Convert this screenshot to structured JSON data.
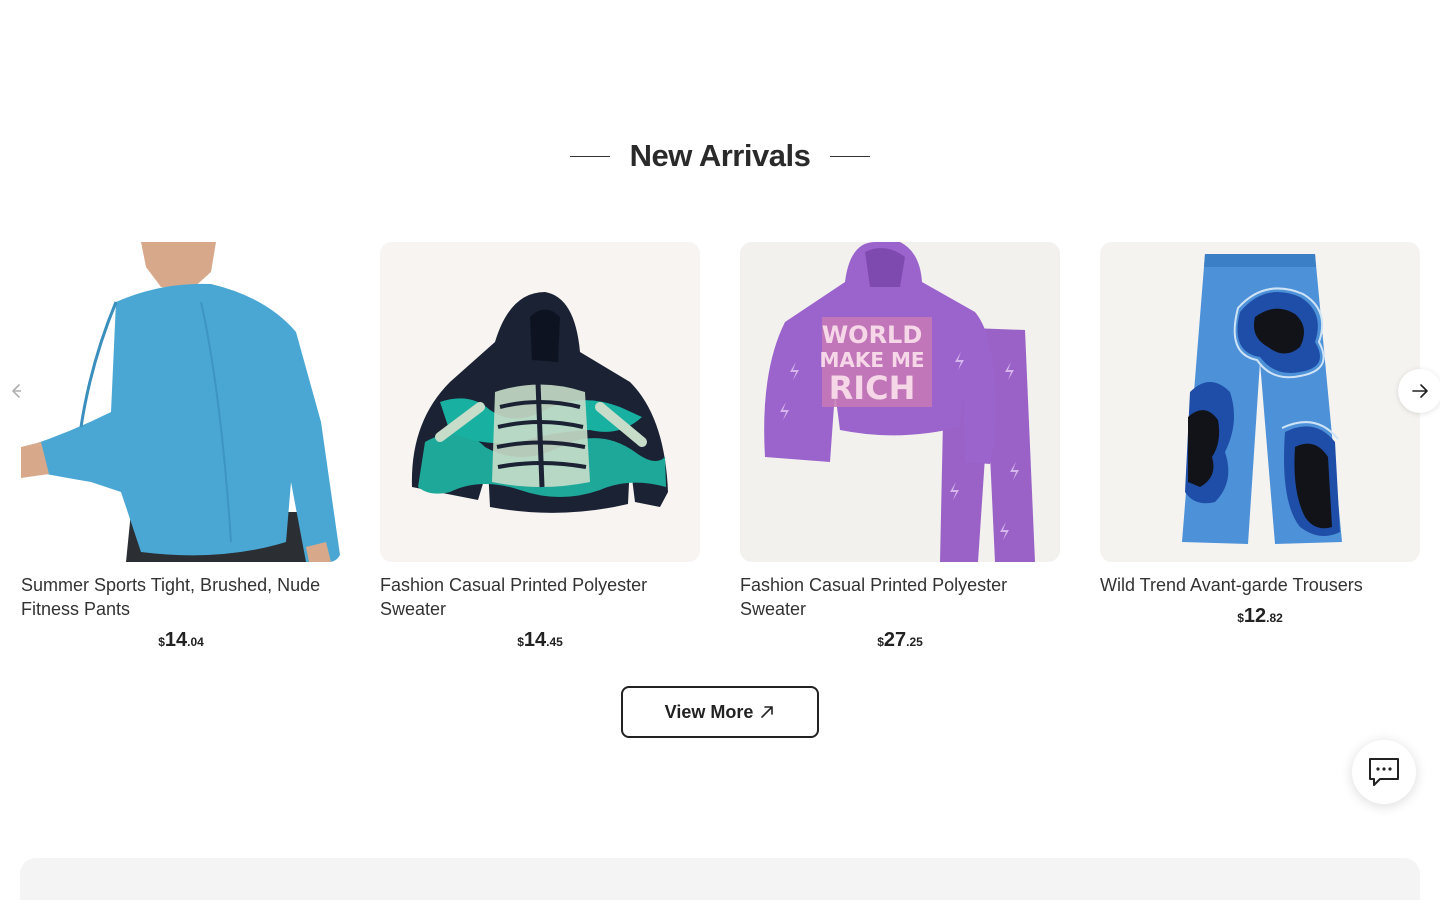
{
  "section": {
    "title": "New Arrivals"
  },
  "products": [
    {
      "name": "Summer Sports Tight, Brushed, Nude Fitness Pants",
      "price_currency": "$",
      "price_int": "14",
      "price_dec": ".04",
      "image_icon": "blue-longsleeve-shirt-image"
    },
    {
      "name": "Fashion Casual Printed Polyester Sweater",
      "price_currency": "$",
      "price_int": "14",
      "price_dec": ".45",
      "image_icon": "skeleton-hoodie-image"
    },
    {
      "name": "Fashion Casual Printed Polyester Sweater",
      "price_currency": "$",
      "price_int": "27",
      "price_dec": ".25",
      "image_icon": "purple-tracksuit-image",
      "image_text_lines": [
        "WORLD",
        "MAKE ME",
        "RICH"
      ]
    },
    {
      "name": "Wild Trend Avant-garde Trousers",
      "price_currency": "$",
      "price_int": "12",
      "price_dec": ".82",
      "image_icon": "blue-camo-trousers-image"
    }
  ],
  "controls": {
    "prev_icon": "arrow-left-icon",
    "next_icon": "arrow-right-icon",
    "view_more_label": "View More",
    "view_more_icon": "arrow-up-right-icon",
    "chat_icon": "chat-bubble-icon"
  },
  "colors": {
    "accent": "#222222",
    "card_bg": "#f7f5f3",
    "panel_bg": "#f4f4f4"
  }
}
